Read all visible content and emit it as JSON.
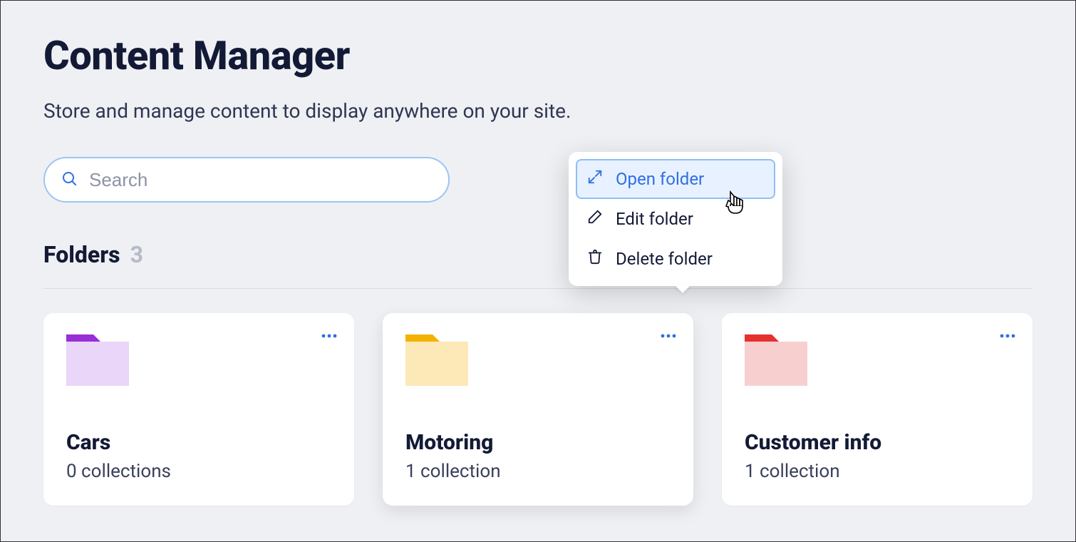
{
  "header": {
    "title": "Content Manager",
    "subtitle": "Store and manage content to display anywhere on your site."
  },
  "search": {
    "placeholder": "Search"
  },
  "folders": {
    "label": "Folders",
    "count": "3",
    "items": [
      {
        "name": "Cars",
        "subtitle": "0 collections",
        "tab_color": "#9a2ed6",
        "body_color": "#e9d6f8"
      },
      {
        "name": "Motoring",
        "subtitle": "1 collection",
        "tab_color": "#f3b100",
        "body_color": "#fde9b8"
      },
      {
        "name": "Customer info",
        "subtitle": "1 collection",
        "tab_color": "#e5322f",
        "body_color": "#f8cfcf"
      }
    ]
  },
  "context_menu": {
    "items": [
      {
        "icon": "expand-icon",
        "label": "Open folder",
        "selected": true
      },
      {
        "icon": "pencil-icon",
        "label": "Edit folder",
        "selected": false
      },
      {
        "icon": "trash-icon",
        "label": "Delete folder",
        "selected": false
      }
    ]
  }
}
